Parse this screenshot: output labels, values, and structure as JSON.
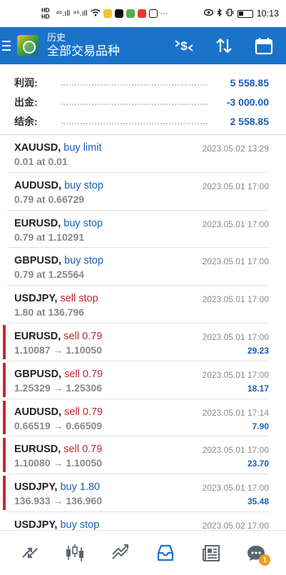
{
  "status_bar": {
    "hd_top": "HD",
    "hd_bottom": "HD",
    "signal_1": "⁴⁶.ıll",
    "signal_2": "⁴⁶.ıll",
    "dots": "···",
    "time": "10:13"
  },
  "app_bar": {
    "subtitle": "历史",
    "title": "全部交易品种"
  },
  "summary": [
    {
      "label": "利润:",
      "value": "5 558.85"
    },
    {
      "label": "出金:",
      "value": "-3 000.00"
    },
    {
      "label": "结余:",
      "value": "2 558.85"
    }
  ],
  "orders": [
    {
      "symbol": "XAUUSD,",
      "type": " buy limit",
      "side": "buy",
      "detail": "0.01 at 0.01",
      "date": "2023.05.02 13:29",
      "profit": "",
      "closed": false
    },
    {
      "symbol": "AUDUSD,",
      "type": " buy stop",
      "side": "buy",
      "detail": "0.79 at 0.66729",
      "date": "2023.05.01 17:00",
      "profit": "",
      "closed": false
    },
    {
      "symbol": "EURUSD,",
      "type": " buy stop",
      "side": "buy",
      "detail": "0.79 at 1.10291",
      "date": "2023.05.01 17:00",
      "profit": "",
      "closed": false
    },
    {
      "symbol": "GBPUSD,",
      "type": " buy stop",
      "side": "buy",
      "detail": "0.79 at 1.25564",
      "date": "2023.05.01 17:00",
      "profit": "",
      "closed": false
    },
    {
      "symbol": "USDJPY,",
      "type": " sell stop",
      "side": "sell",
      "detail": "1.80 at 136.796",
      "date": "2023.05.01 17:00",
      "profit": "",
      "closed": false
    },
    {
      "symbol": "EURUSD,",
      "type": " sell 0.79",
      "side": "sell",
      "detail": "1.10087 → 1.10050",
      "date": "2023.05.01 17:00",
      "profit": "29.23",
      "closed": true
    },
    {
      "symbol": "GBPUSD,",
      "type": " sell 0.79",
      "side": "sell",
      "detail": "1.25329 → 1.25306",
      "date": "2023.05.01 17:00",
      "profit": "18.17",
      "closed": true
    },
    {
      "symbol": "AUDUSD,",
      "type": " sell 0.79",
      "side": "sell",
      "detail": "0.66519 → 0.66509",
      "date": "2023.05.01 17:14",
      "profit": "7.90",
      "closed": true
    },
    {
      "symbol": "EURUSD,",
      "type": " sell 0.79",
      "side": "sell",
      "detail": "1.10080 → 1.10050",
      "date": "2023.05.01 17:00",
      "profit": "23.70",
      "closed": true
    },
    {
      "symbol": "USDJPY,",
      "type": " buy 1.80",
      "side": "buy",
      "detail": "136.933 → 136.960",
      "date": "2023.05.01 17:00",
      "profit": "35.48",
      "closed": true
    },
    {
      "symbol": "USDJPY,",
      "type": " buy stop",
      "side": "buy",
      "detail": "",
      "date": "2023.05.02 17:00",
      "profit": "",
      "closed": false
    }
  ],
  "tab_bar": {
    "tabs": [
      "quotes-icon",
      "chart-icon",
      "trade-icon",
      "history-icon",
      "news-icon",
      "messages-icon"
    ],
    "active": "history-icon",
    "messages_badge": "1"
  },
  "colors": {
    "app_bar": "#1a73c9",
    "buy": "#1a5fb4",
    "sell": "#c0242f",
    "closed_marker": "#d3232f",
    "badge": "#f39c12"
  }
}
